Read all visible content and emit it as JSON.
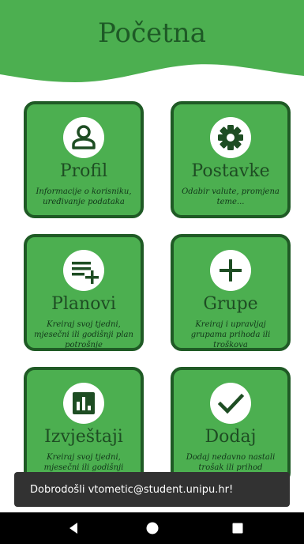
{
  "header": {
    "title": "Početna"
  },
  "colors": {
    "header_green": "#4caf50",
    "card_green": "#4caf50",
    "card_border": "#1f5a25",
    "title_dark": "#1e5a26"
  },
  "cards": [
    {
      "title": "Profil",
      "desc": "Informacije o korisniku, uređivanje podataka",
      "icon": "person-icon"
    },
    {
      "title": "Postavke",
      "desc": "Odabir valute, promjena teme...",
      "icon": "gear-icon"
    },
    {
      "title": "Planovi",
      "desc": "Kreiraj svoj tjedni, mjesečni ili godišnji plan potrošnje",
      "icon": "playlist-add-icon"
    },
    {
      "title": "Grupe",
      "desc": "Kreiraj i upravljaj grupama prihoda ili troškova",
      "icon": "plus-icon"
    },
    {
      "title": "Izvještaji",
      "desc": "Kreiraj svoj tjedni, mjesečni ili godišnji izvještaj",
      "icon": "bar-chart-icon"
    },
    {
      "title": "Dodaj",
      "desc": "Dodaj nedavno nastali trošak ili prihod",
      "icon": "check-icon"
    }
  ],
  "snackbar": {
    "message": "Dobrodošli vtometic@student.unipu.hr!"
  },
  "navbar": {
    "icons": [
      "back-icon",
      "home-icon",
      "recents-icon"
    ]
  }
}
